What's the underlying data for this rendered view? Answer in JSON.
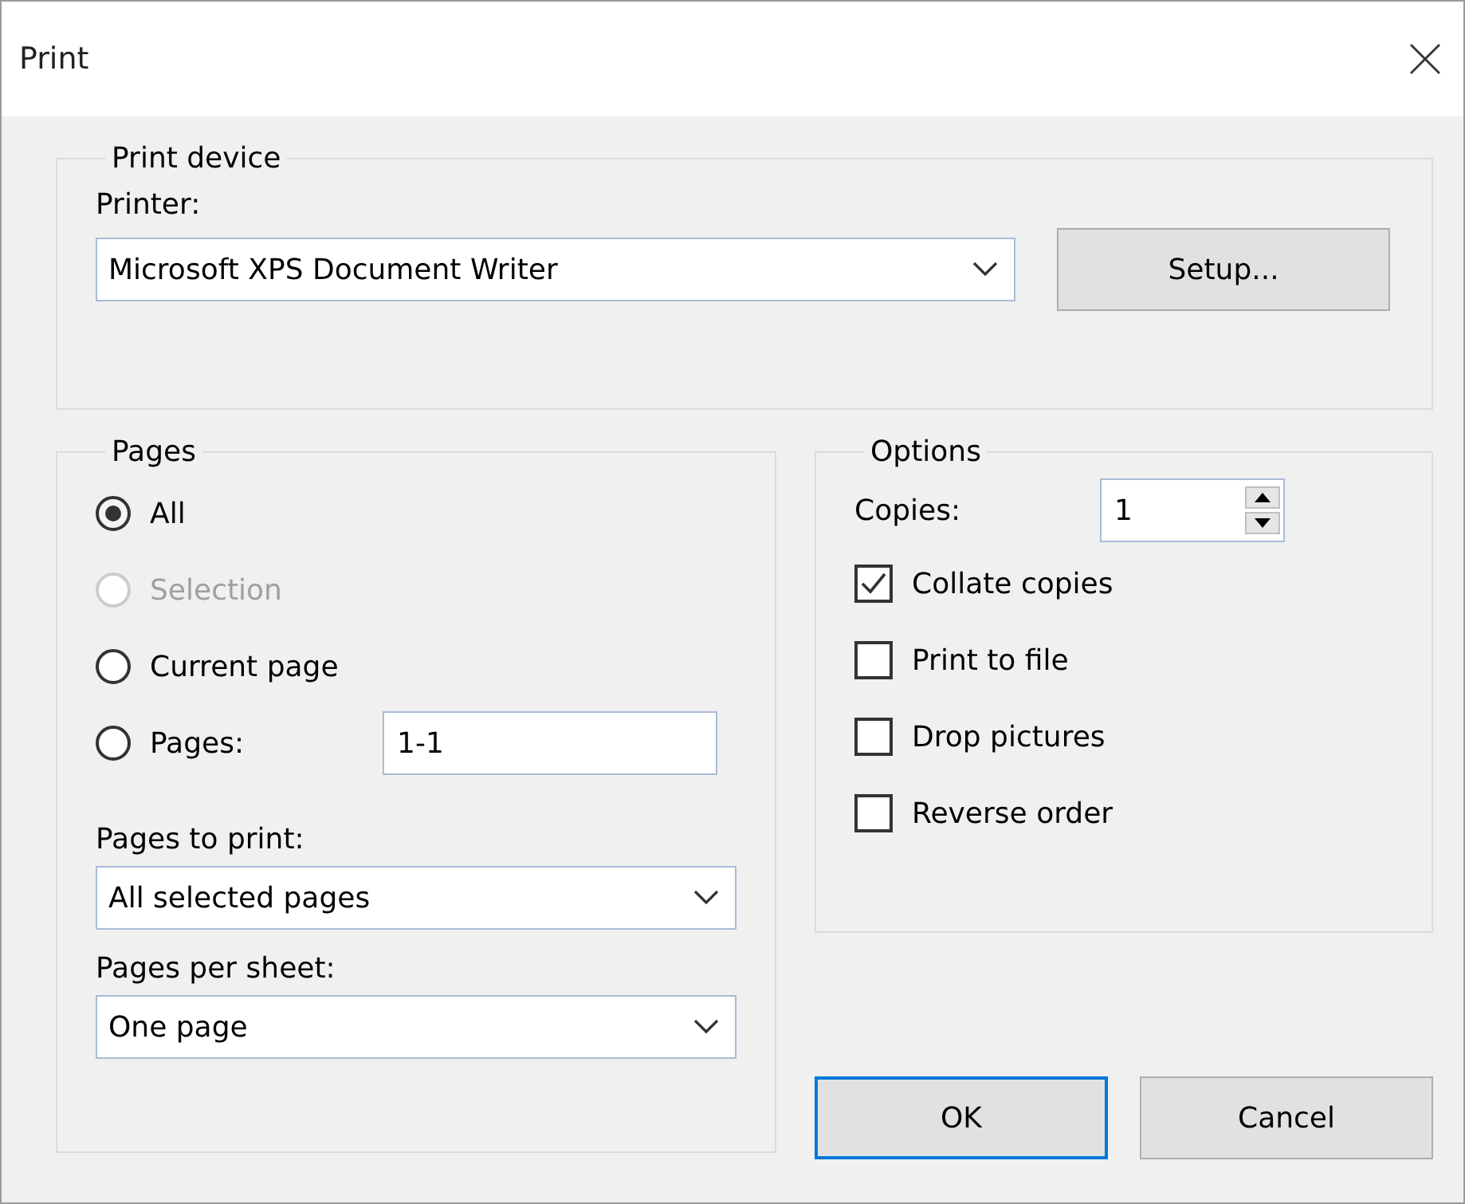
{
  "window": {
    "title": "Print"
  },
  "print_device": {
    "title": "Print device",
    "printer_label": "Printer:",
    "printer": "Microsoft XPS Document Writer",
    "setup_button": "Setup..."
  },
  "pages": {
    "title": "Pages",
    "choices": [
      {
        "kind": "plain",
        "label": "All",
        "selected": true,
        "disabled": false
      },
      {
        "kind": "plain",
        "label": "Selection",
        "selected": false,
        "disabled": true
      },
      {
        "kind": "plain",
        "label": "Current page",
        "selected": false,
        "disabled": false
      },
      {
        "kind": "range",
        "label": "Pages:",
        "selected": false,
        "disabled": false,
        "value": "1-1"
      }
    ],
    "pages_to_print_label": "Pages to print:",
    "pages_to_print": "All selected pages",
    "pages_per_sheet_label": "Pages per sheet:",
    "pages_per_sheet": "One page"
  },
  "options": {
    "title": "Options",
    "copies_label": "Copies:",
    "copies": "1",
    "checkboxes": [
      {
        "label": "Collate copies",
        "checked": true
      },
      {
        "label": "Print to file",
        "checked": false
      },
      {
        "label": "Drop pictures",
        "checked": false
      },
      {
        "label": "Reverse order",
        "checked": false
      }
    ]
  },
  "buttons": [
    {
      "label": "OK",
      "default": true
    },
    {
      "label": "Cancel",
      "default": false
    }
  ]
}
